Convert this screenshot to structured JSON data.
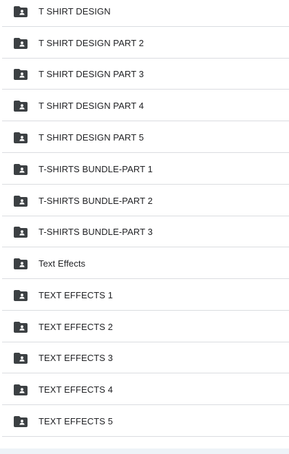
{
  "folders": [
    {
      "name": "T SHIRT DESIGN",
      "icon": "shared-folder-icon"
    },
    {
      "name": "T SHIRT DESIGN PART 2",
      "icon": "shared-folder-icon"
    },
    {
      "name": "T SHIRT DESIGN PART 3",
      "icon": "shared-folder-icon"
    },
    {
      "name": "T SHIRT DESIGN PART 4",
      "icon": "shared-folder-icon"
    },
    {
      "name": "T SHIRT DESIGN PART 5",
      "icon": "shared-folder-icon"
    },
    {
      "name": "T-SHIRTS BUNDLE-PART 1",
      "icon": "shared-folder-icon"
    },
    {
      "name": "T-SHIRTS BUNDLE-PART 2",
      "icon": "shared-folder-icon"
    },
    {
      "name": "T-SHIRTS BUNDLE-PART 3",
      "icon": "shared-folder-icon"
    },
    {
      "name": "Text Effects",
      "icon": "shared-folder-icon"
    },
    {
      "name": "TEXT EFFECTS 1",
      "icon": "shared-folder-icon"
    },
    {
      "name": "TEXT EFFECTS 2",
      "icon": "shared-folder-icon"
    },
    {
      "name": "TEXT EFFECTS 3",
      "icon": "shared-folder-icon"
    },
    {
      "name": "TEXT EFFECTS 4",
      "icon": "shared-folder-icon"
    },
    {
      "name": "TEXT EFFECTS 5",
      "icon": "shared-folder-icon"
    }
  ],
  "colors": {
    "icon": "#3c4043",
    "text": "#202124",
    "divider": "#dadce0",
    "footer": "#eef3f8"
  }
}
